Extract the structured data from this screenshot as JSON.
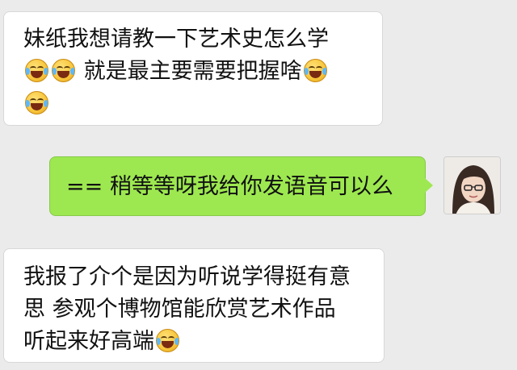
{
  "messages": [
    {
      "direction": "incoming",
      "lines": [
        "妹纸我想请教一下艺术史怎么学",
        "就是最主要需要把握啥"
      ],
      "emoji_name": "face-with-tears-of-joy"
    },
    {
      "direction": "outgoing",
      "text": "== 稍等等呀我给你发语音可以么"
    },
    {
      "direction": "incoming",
      "lines": [
        "我报了介个是因为听说学得挺有意",
        "思 参观个博物馆能欣赏艺术作品",
        "听起来好高端"
      ],
      "emoji_name": "face-with-tears-of-joy"
    }
  ],
  "colors": {
    "background": "#ebebeb",
    "incoming_bubble": "#ffffff",
    "outgoing_bubble": "#9de850",
    "text": "#111111"
  }
}
